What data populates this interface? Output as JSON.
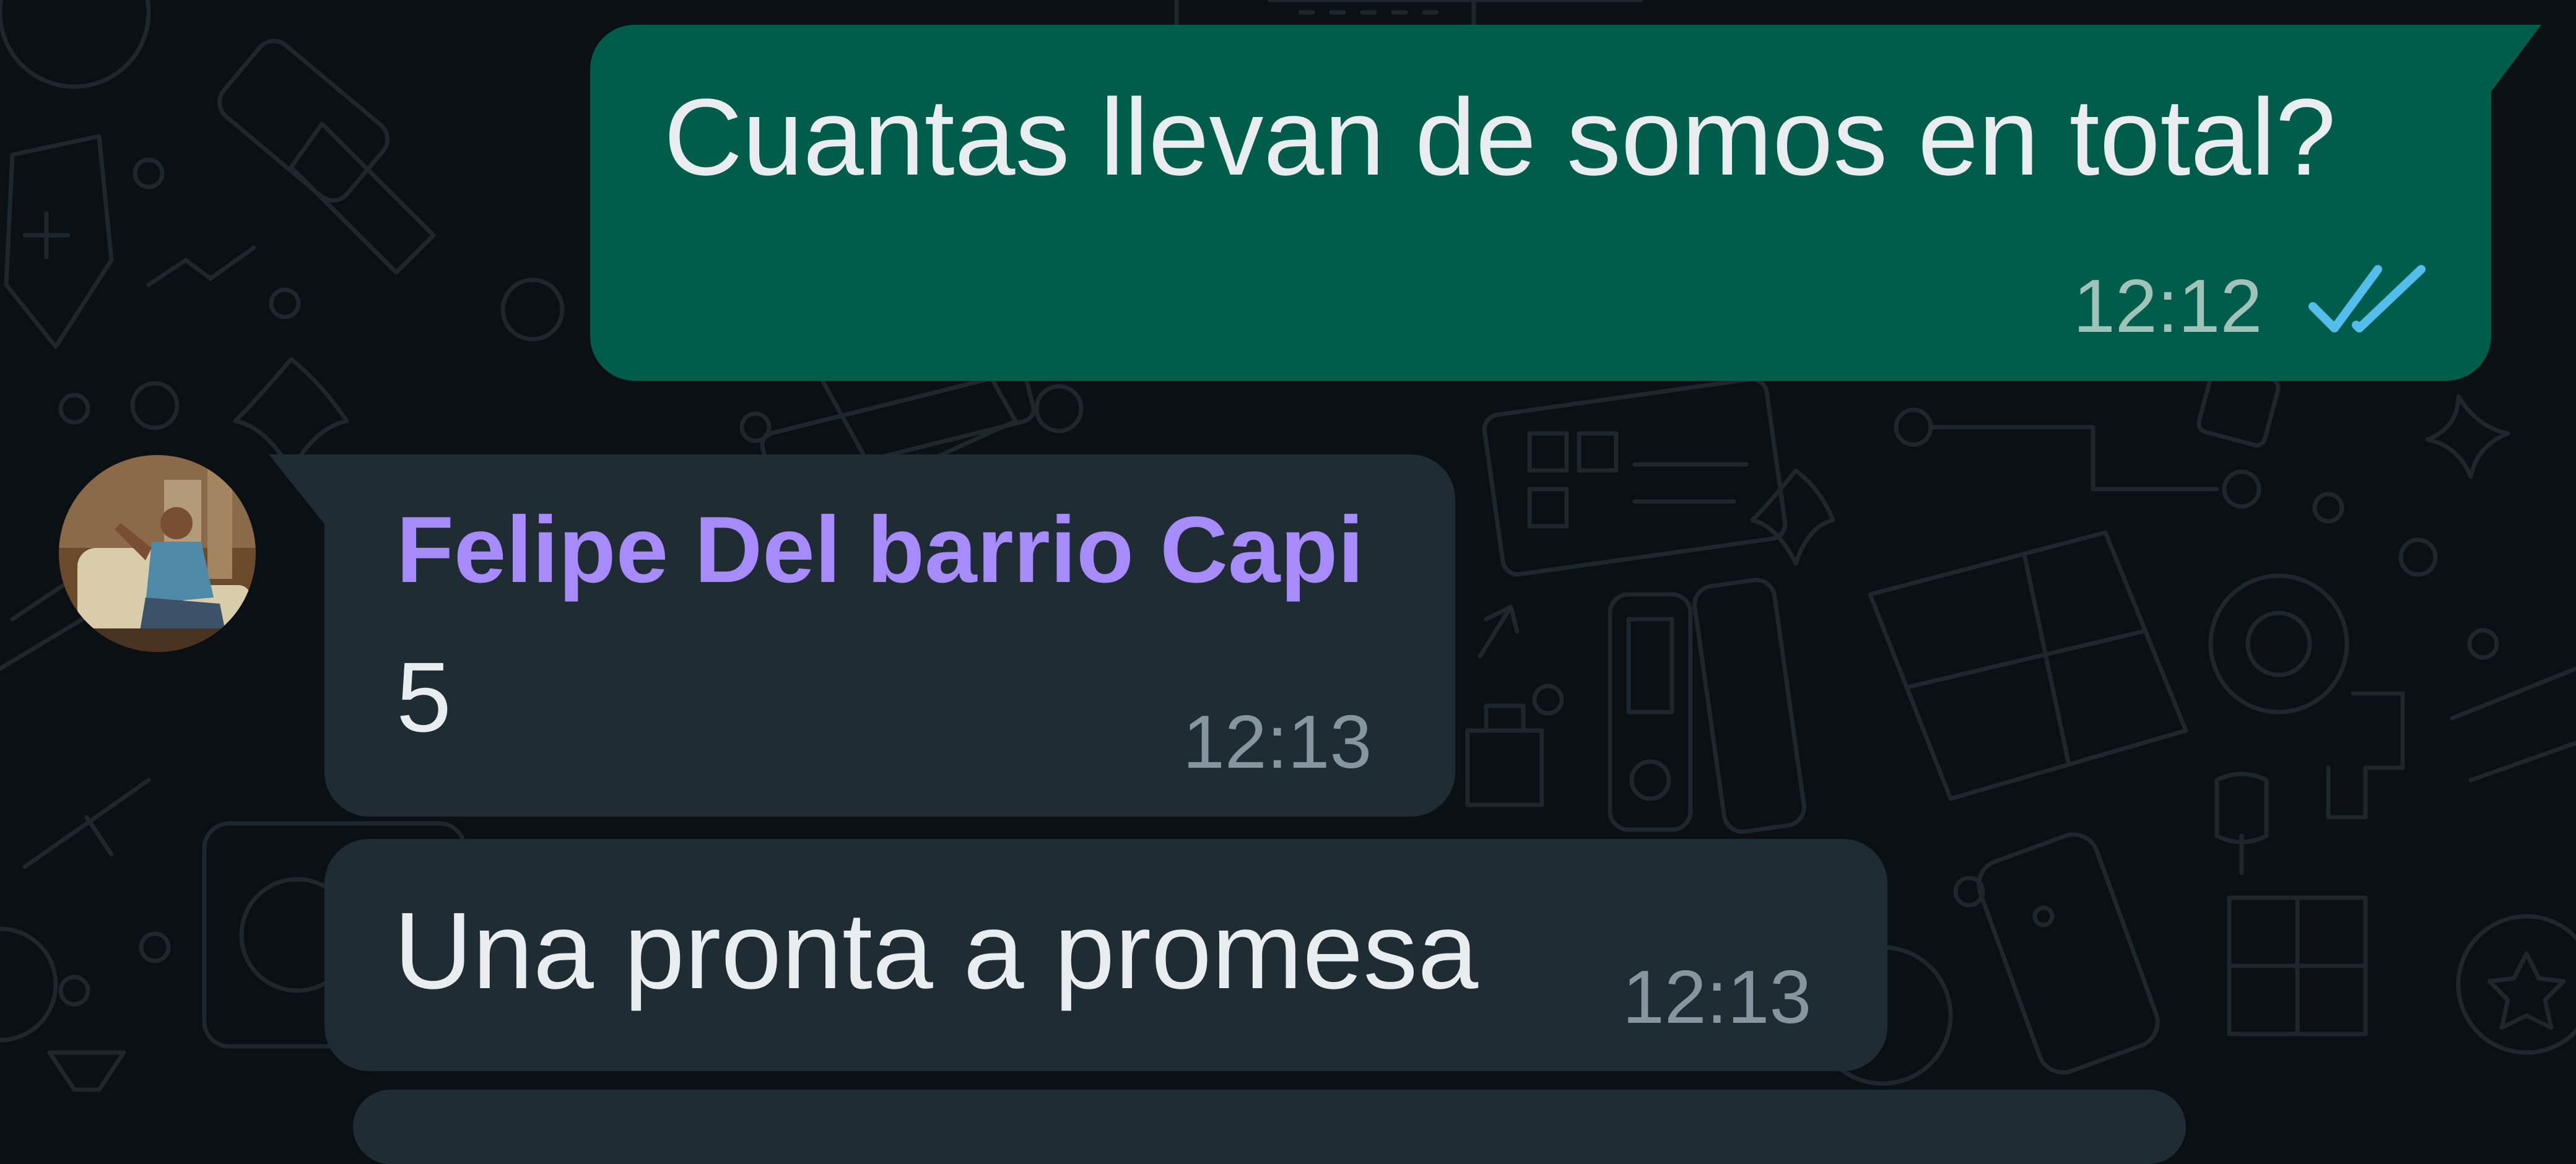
{
  "chat": {
    "messages": [
      {
        "direction": "outgoing",
        "text": "Cuantas llevan de somos en total?",
        "time": "12:12",
        "status_icon": "double-check-read-icon"
      },
      {
        "direction": "incoming",
        "sender": "Felipe Del barrio Capi",
        "text": "5",
        "time": "12:13"
      },
      {
        "direction": "incoming",
        "text": "Una pronta a promesa",
        "time": "12:13"
      }
    ]
  },
  "colors": {
    "background": "#0b1014",
    "outgoing_bubble": "#005c4b",
    "incoming_bubble": "#202c33",
    "sender_name": "#a78bfa",
    "read_ticks": "#53bdeb",
    "timestamp": "#8696a0"
  }
}
